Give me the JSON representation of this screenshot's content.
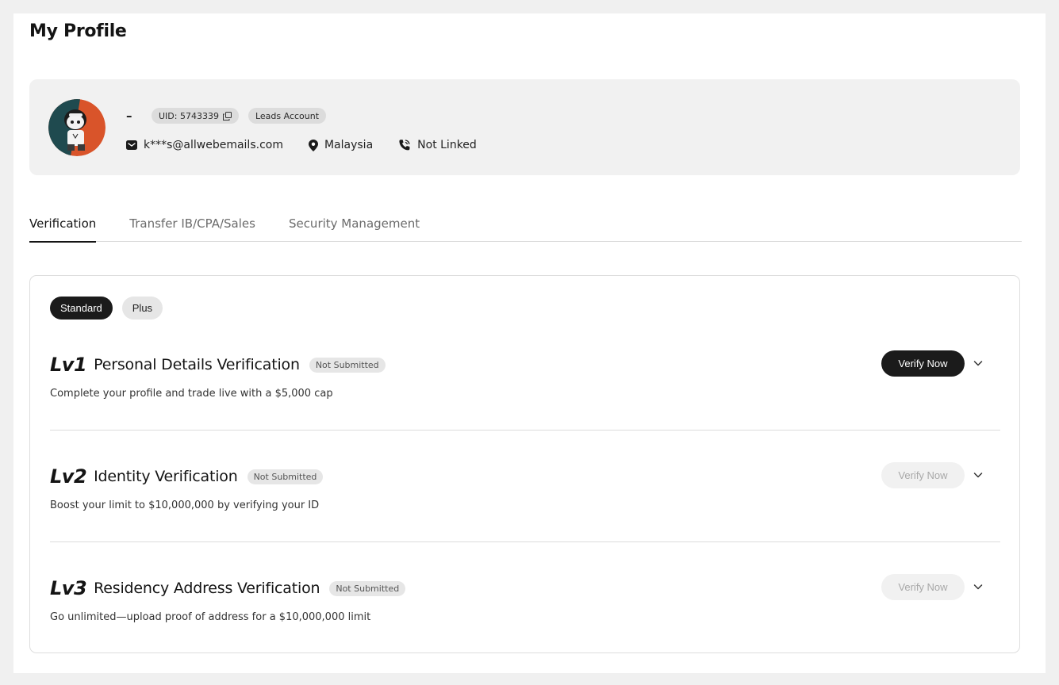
{
  "page": {
    "title": "My Profile"
  },
  "profile": {
    "name": "–",
    "uid_label": "UID: 5743339",
    "account_type": "Leads Account",
    "email": "k***s@allwebemails.com",
    "country": "Malaysia",
    "phone_status": "Not Linked"
  },
  "tabs": [
    {
      "label": "Verification",
      "active": true
    },
    {
      "label": "Transfer IB/CPA/Sales",
      "active": false
    },
    {
      "label": "Security Management",
      "active": false
    }
  ],
  "segment": {
    "options": [
      {
        "label": "Standard",
        "active": true
      },
      {
        "label": "Plus",
        "active": false
      }
    ]
  },
  "levels": [
    {
      "tag": "Lv1",
      "title": "Personal Details Verification",
      "status": "Not Submitted",
      "description": "Complete your profile and trade live with a $5,000 cap",
      "button": "Verify Now",
      "button_enabled": true
    },
    {
      "tag": "Lv2",
      "title": "Identity Verification",
      "status": "Not Submitted",
      "description": "Boost your limit to $10,000,000 by verifying your ID",
      "button": "Verify Now",
      "button_enabled": false
    },
    {
      "tag": "Lv3",
      "title": "Residency Address Verification",
      "status": "Not Submitted",
      "description": "Go unlimited—upload proof of address for a $10,000,000 limit",
      "button": "Verify Now",
      "button_enabled": false
    }
  ],
  "colors": {
    "primary_button": "#1b1b1b",
    "disabled_button": "#f1f1f1",
    "card_bg": "#f1f1f1",
    "avatar_bg": "#d9542a"
  },
  "icons": {
    "email": "envelope-icon",
    "location": "map-pin-icon",
    "phone": "phone-icon",
    "copy": "copy-icon",
    "expand": "chevron-down-icon"
  }
}
